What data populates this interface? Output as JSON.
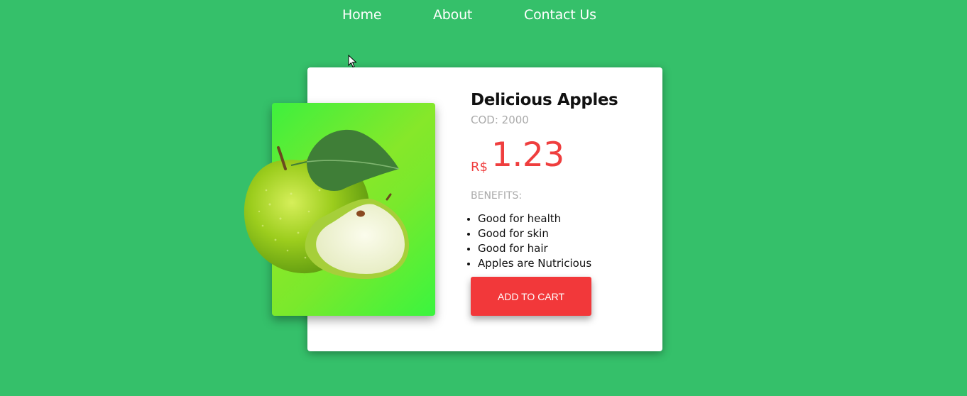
{
  "nav": {
    "home": "Home",
    "about": "About",
    "contact": "Contact Us"
  },
  "product": {
    "title": "Delicious Apples",
    "code": "COD: 2000",
    "currency": "R$",
    "price": "1.23",
    "benefits_label": "BENEFITS:",
    "benefits": [
      "Good for health",
      "Good for skin",
      "Good for hair",
      "Apples are Nutricious"
    ],
    "image": "green-apple-image",
    "add_to_cart_label": "ADD TO CART"
  },
  "colors": {
    "background": "#35c06a",
    "accent": "#f2383a",
    "price": "#ef3e3e"
  }
}
